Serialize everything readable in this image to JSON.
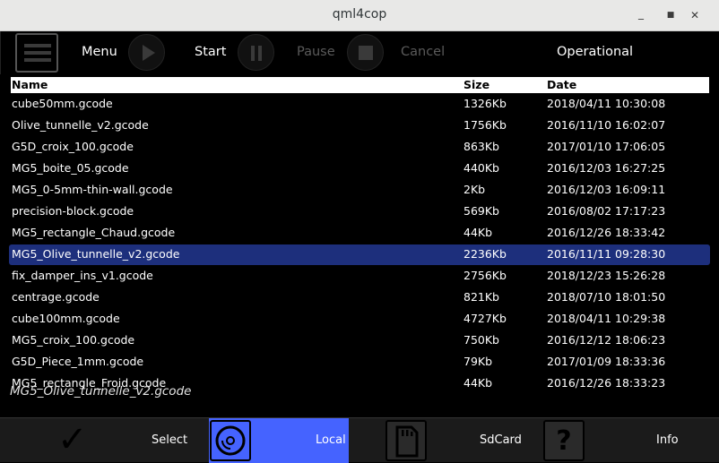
{
  "window": {
    "title": "qml4cop",
    "minimize_glyph": "_",
    "maximize_glyph": "■",
    "close_glyph": "✕"
  },
  "toolbar": {
    "menu_label": "Menu",
    "start_label": "Start",
    "pause_label": "Pause",
    "cancel_label": "Cancel",
    "status": "Operational"
  },
  "table": {
    "columns": [
      "Name",
      "Size",
      "Date"
    ],
    "rows": [
      {
        "name": "cube50mm.gcode",
        "size": "1326Kb",
        "date": "2018/04/11 10:30:08"
      },
      {
        "name": "Olive_tunnelle_v2.gcode",
        "size": "1756Kb",
        "date": "2016/11/10 16:02:07"
      },
      {
        "name": "G5D_croix_100.gcode",
        "size": "863Kb",
        "date": "2017/01/10 17:06:05"
      },
      {
        "name": "MG5_boite_05.gcode",
        "size": "440Kb",
        "date": "2016/12/03 16:27:25"
      },
      {
        "name": "MG5_0-5mm-thin-wall.gcode",
        "size": "2Kb",
        "date": "2016/12/03 16:09:11"
      },
      {
        "name": "precision-block.gcode",
        "size": "569Kb",
        "date": "2016/08/02 17:17:23"
      },
      {
        "name": "MG5_rectangle_Chaud.gcode",
        "size": "44Kb",
        "date": "2016/12/26 18:33:42"
      },
      {
        "name": "MG5_Olive_tunnelle_v2.gcode",
        "size": "2236Kb",
        "date": "2016/11/11 09:28:30"
      },
      {
        "name": "fix_damper_ins_v1.gcode",
        "size": "2756Kb",
        "date": "2018/12/23 15:26:28"
      },
      {
        "name": "centrage.gcode",
        "size": "821Kb",
        "date": "2018/07/10 18:01:50"
      },
      {
        "name": "cube100mm.gcode",
        "size": "4727Kb",
        "date": "2018/04/11 10:29:38"
      },
      {
        "name": "MG5_croix_100.gcode",
        "size": "750Kb",
        "date": "2016/12/12 18:06:23"
      },
      {
        "name": "G5D_Piece_1mm.gcode",
        "size": "79Kb",
        "date": "2017/01/09 18:33:36"
      },
      {
        "name": "MG5_rectangle_Froid.gcode",
        "size": "44Kb",
        "date": "2016/12/26 18:33:23"
      }
    ],
    "selected_index": 7
  },
  "selected_file": "MG5_Olive_tunnelle_v2.gcode",
  "bottombar": {
    "select_label": "Select",
    "local_label": "Local",
    "sdcard_label": "SdCard",
    "info_label": "Info",
    "info_glyph": "?",
    "check_glyph": "✓"
  },
  "colors": {
    "selection": "#1d2f7c",
    "active_tab": "#4563ff"
  }
}
